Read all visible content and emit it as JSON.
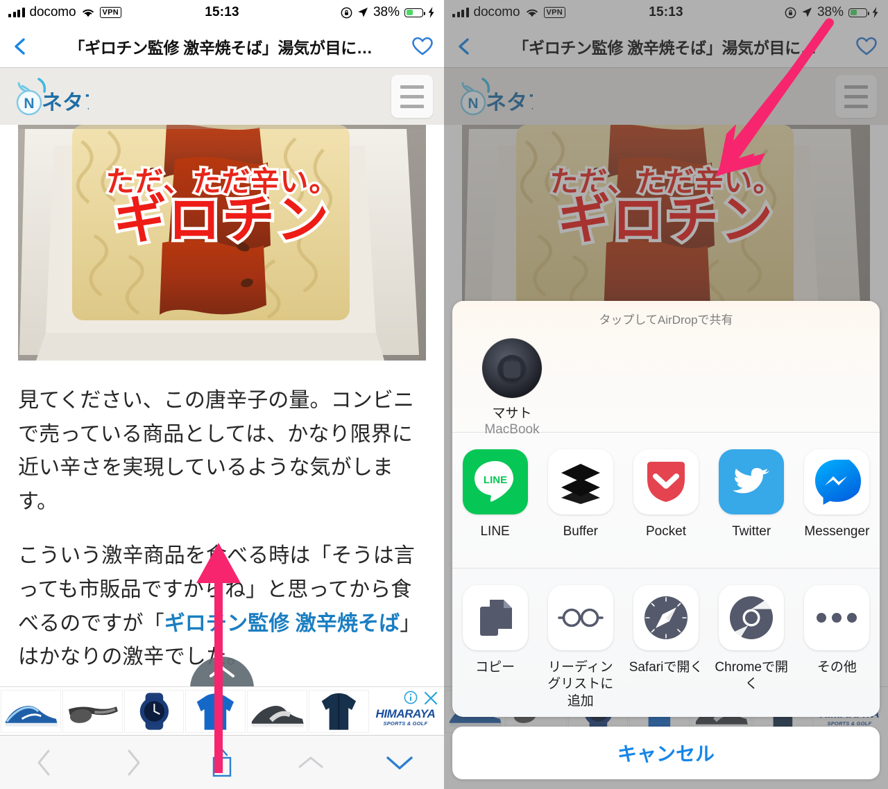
{
  "status_bar": {
    "carrier": "docomo",
    "vpn": "VPN",
    "time": "15:13",
    "battery_percent": "38%",
    "icons": [
      "signal-bars-icon",
      "wifi-icon",
      "vpn-badge",
      "rotation-lock-icon",
      "location-arrow-icon",
      "battery-icon",
      "charging-bolt-icon"
    ]
  },
  "nav_bar": {
    "back_label": "back-chevron",
    "title": "「ギロチン監修 激辛焼そば」湯気が目に…",
    "favorite_label": "heart"
  },
  "site_header": {
    "logo_text": "ネタフル",
    "menu_label": "menu"
  },
  "hero": {
    "caption_top": "ただ、ただ辛い。",
    "caption_main": "ギロチン"
  },
  "article": {
    "paragraph_1": "見てください、この唐辛子の量。コンビニで売っている商品としては、かなり限界に近い辛さを実現しているような気がします。",
    "paragraph_2_before": "こういう激辛商品を食べる時は「そうは言っても市販品ですからね」と思ってから食べるのですが「",
    "paragraph_2_link": "ギロチン監修 激辛焼そば",
    "paragraph_2_after": "」はかなりの激辛でした。"
  },
  "ad": {
    "brand": "HIMARAYA",
    "brand_sub": "SPORTS & GOLF",
    "info_label": "ad-info",
    "close_label": "ad-close",
    "products": [
      {
        "name": "running-shoe-blue"
      },
      {
        "name": "sunglasses"
      },
      {
        "name": "sport-watch-blue"
      },
      {
        "name": "blue-jacket"
      },
      {
        "name": "sneaker-grey"
      },
      {
        "name": "navy-jacket"
      }
    ]
  },
  "toolbar": {
    "items": [
      {
        "name": "back-chevron-icon",
        "state": "disabled"
      },
      {
        "name": "forward-chevron-icon",
        "state": "disabled"
      },
      {
        "name": "share-icon",
        "state": "active"
      },
      {
        "name": "chevron-up-icon",
        "state": "disabled"
      },
      {
        "name": "chevron-down-icon",
        "state": "active"
      }
    ]
  },
  "share_sheet": {
    "airdrop_title": "タップしてAirDropで共有",
    "airdrop_device": {
      "name": "マサト",
      "model": "MacBook"
    },
    "apps_row_1": [
      {
        "label": "LINE",
        "icon": "line-icon"
      },
      {
        "label": "Buffer",
        "icon": "buffer-icon"
      },
      {
        "label": "Pocket",
        "icon": "pocket-icon"
      },
      {
        "label": "Twitter",
        "icon": "twitter-icon"
      },
      {
        "label": "Messenger",
        "icon": "messenger-icon"
      }
    ],
    "apps_row_2": [
      {
        "label": "コピー",
        "icon": "copy-icon"
      },
      {
        "label": "リーディングリストに追加",
        "icon": "glasses-icon"
      },
      {
        "label": "Safariで開く",
        "icon": "safari-icon"
      },
      {
        "label": "Chromeで開く",
        "icon": "chrome-icon"
      },
      {
        "label": "その他",
        "icon": "more-dots-icon"
      }
    ],
    "cancel_label": "キャンセル"
  },
  "annotations": {
    "left_arrow": "pink-arrow-up-to-share-button",
    "right_arrow": "pink-arrow-down-to-pocket"
  },
  "colors": {
    "accent_blue": "#1686e8",
    "pink_arrow": "#F6256E",
    "link_blue": "#1a7ec2",
    "hero_red": "#ed1c16"
  }
}
